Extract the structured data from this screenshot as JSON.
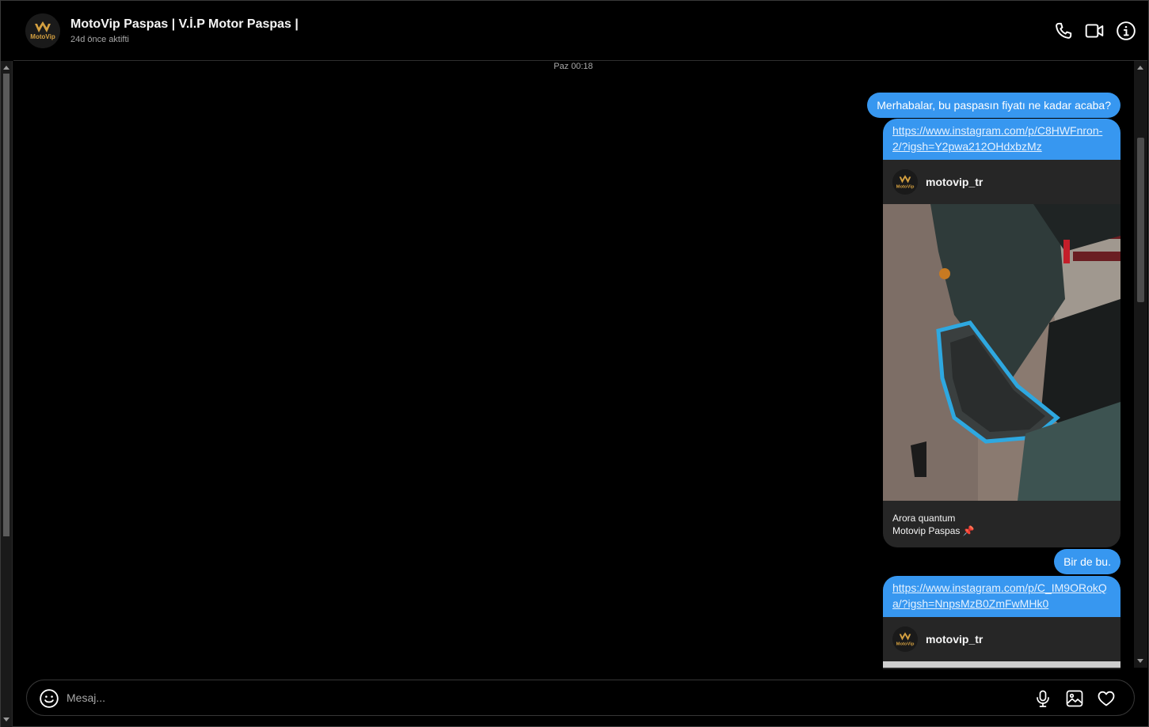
{
  "header": {
    "title": "MotoVip Paspas | V.İ.P Motor Paspas |",
    "status": "24d önce aktifti",
    "avatar_brand": "MotoVip"
  },
  "chat": {
    "timestamp": "Paz 00:18",
    "messages": [
      {
        "type": "text",
        "text": "Merhabalar, bu paspasın fiyatı ne kadar acaba?"
      },
      {
        "type": "shared_post",
        "link": "https://www.instagram.com/p/C8HWFnron-2/?igsh=Y2pwa212OHdxbzMz",
        "author": "motovip_tr",
        "caption_line1": "Arora quantum",
        "caption_line2": "Motovip Paspas",
        "caption_icon": "pushpin-icon"
      },
      {
        "type": "text",
        "text": "Bir de bu."
      },
      {
        "type": "shared_post",
        "link": "https://www.instagram.com/p/C_IM9ORokQa/?igsh=NnpsMzB0ZmFwMHk0",
        "author": "motovip_tr"
      }
    ]
  },
  "composer": {
    "placeholder": "Mesaj..."
  },
  "colors": {
    "accent": "#3797f0",
    "background": "#000000",
    "card": "#262626",
    "muted_text": "#a8a8a8"
  },
  "icons": [
    "phone-icon",
    "video-call-icon",
    "info-icon",
    "emoji-icon",
    "microphone-icon",
    "image-icon",
    "heart-icon"
  ]
}
